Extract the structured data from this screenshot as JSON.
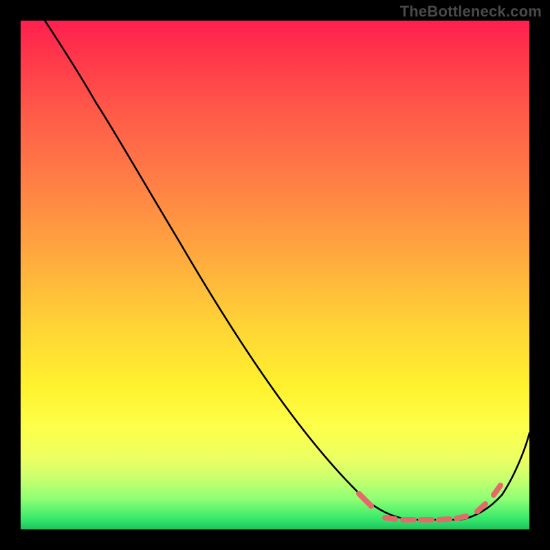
{
  "watermark": "TheBottleneck.com",
  "chart_data": {
    "type": "line",
    "title": "",
    "xlabel": "",
    "ylabel": "",
    "xlim": [
      0,
      100
    ],
    "ylim": [
      0,
      100
    ],
    "grid": false,
    "legend": false,
    "background": "vertical-heat-gradient (red top → green bottom)",
    "series": [
      {
        "name": "bottleneck-curve",
        "color": "#000000",
        "x": [
          4,
          8,
          15,
          22,
          31,
          40,
          50,
          60,
          68,
          73,
          78,
          82,
          86,
          90,
          94,
          98,
          100
        ],
        "y": [
          101,
          94,
          84,
          73,
          57,
          43,
          28,
          15,
          7,
          3,
          2,
          2,
          2,
          3,
          7,
          14,
          19
        ]
      }
    ],
    "markers": {
      "name": "highlight-segment",
      "color": "#e46a6a",
      "x": [
        66,
        72,
        76,
        79,
        82,
        85,
        88,
        91,
        94
      ],
      "y": [
        7,
        3,
        2,
        2,
        2,
        2,
        3,
        5,
        8
      ]
    },
    "notes": "Curve starts above top edge at left, descends roughly linearly then flattens into a valley near x≈75–90 (y≈2), then rises toward right edge. Salmon-colored short dashes overlay the valley region of the curve."
  }
}
